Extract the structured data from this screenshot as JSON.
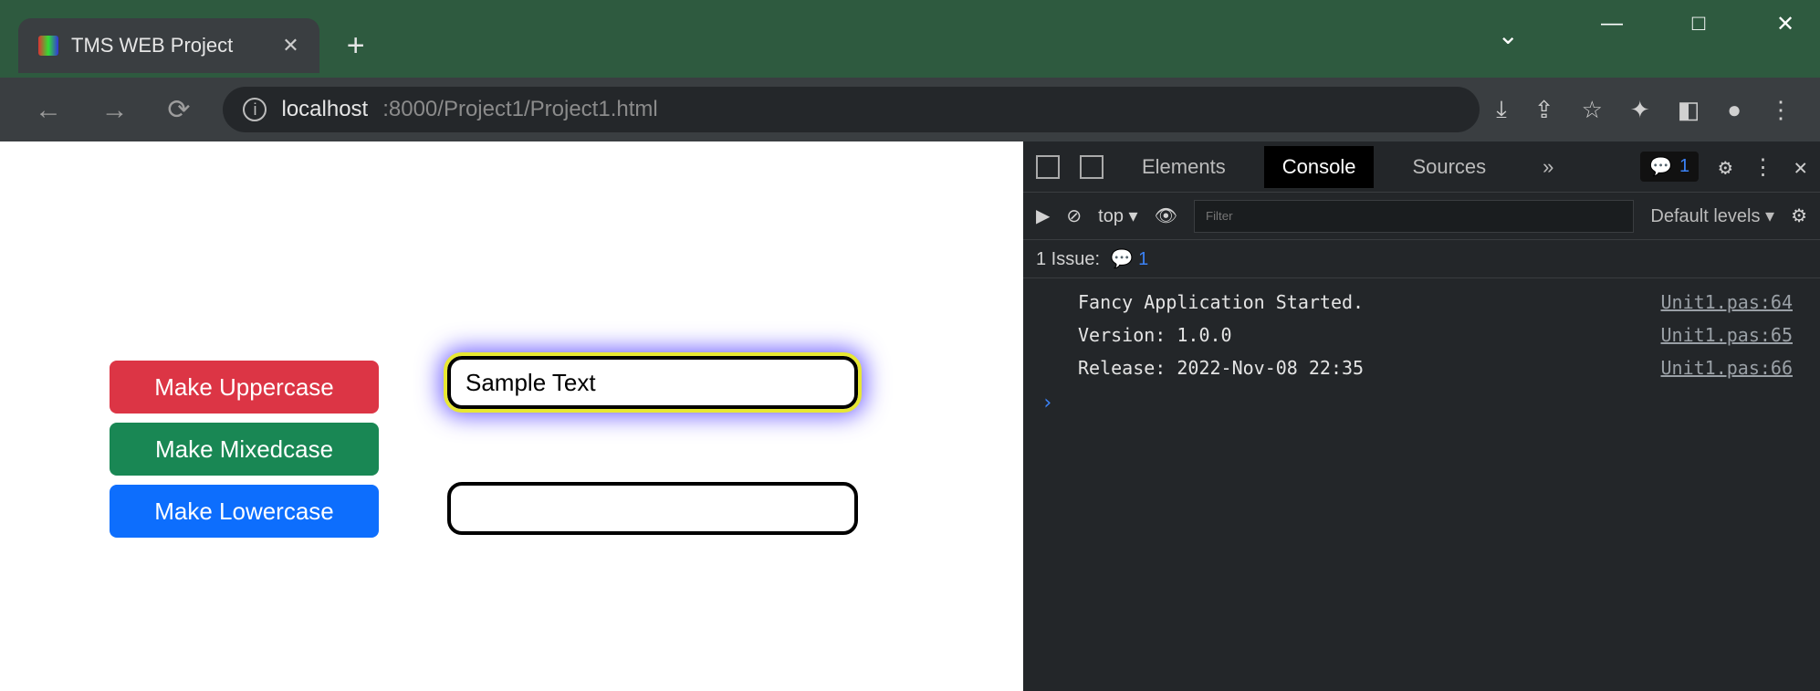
{
  "window": {
    "minimize": "—",
    "maximize": "□",
    "close": "✕",
    "dropdown": "⌄"
  },
  "tab": {
    "title": "TMS WEB Project",
    "close": "✕",
    "newtab": "+"
  },
  "nav": {
    "back": "←",
    "forward": "→",
    "reload": "⟳"
  },
  "url": {
    "info": "i",
    "host": "localhost",
    "rest": ":8000/Project1/Project1.html"
  },
  "toolbar_icons": {
    "download": "⤓",
    "share": "⇪",
    "star": "☆",
    "ext": "✦",
    "side": "◧",
    "profile": "●",
    "menu": "⋮"
  },
  "app": {
    "buttons": {
      "uppercase": "Make Uppercase",
      "mixedcase": "Make Mixedcase",
      "lowercase": "Make Lowercase"
    },
    "input1_value": "Sample Text",
    "input2_value": ""
  },
  "devtools": {
    "tabs": {
      "elements": "Elements",
      "console": "Console",
      "sources": "Sources",
      "more": "»"
    },
    "issue_count": "1",
    "gear": "⚙",
    "kebab": "⋮",
    "close": "✕",
    "toolbar": {
      "play": "▶",
      "noentry": "⊘",
      "context": "top ▾",
      "eye": "👁",
      "filter_placeholder": "Filter",
      "levels": "Default levels ▾",
      "gear": "⚙"
    },
    "issuebar": {
      "label": "1 Issue:",
      "count": "1"
    },
    "logs": [
      {
        "msg": "Fancy Application Started.",
        "src": "Unit1.pas:64"
      },
      {
        "msg": "Version: 1.0.0",
        "src": "Unit1.pas:65"
      },
      {
        "msg": "Release: 2022-Nov-08 22:35",
        "src": "Unit1.pas:66"
      }
    ],
    "prompt": "›"
  }
}
